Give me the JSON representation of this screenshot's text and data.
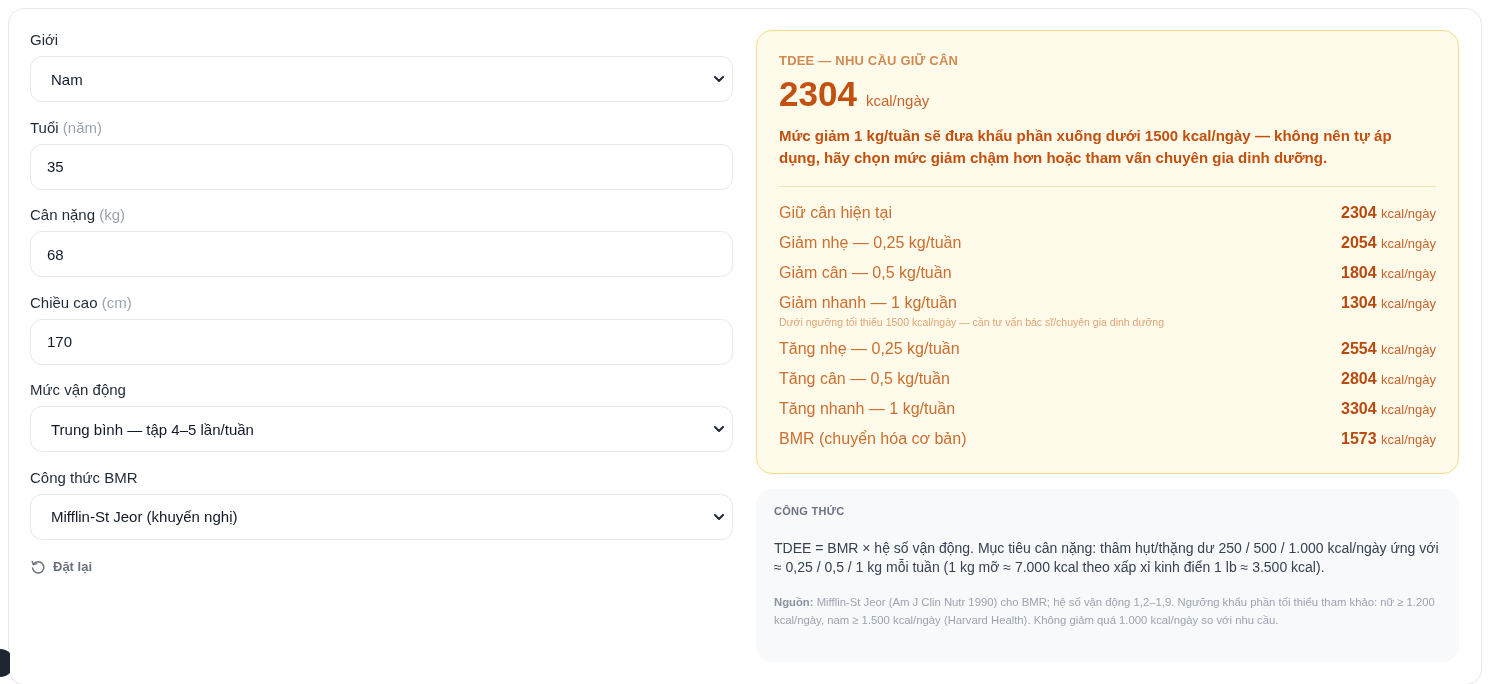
{
  "form": {
    "fields": [
      {
        "kind": "select",
        "label": "Giới",
        "value": "Nam"
      },
      {
        "kind": "number",
        "label": "Tuổi",
        "unit": "(năm)",
        "value": "35"
      },
      {
        "kind": "number",
        "label": "Cân nặng",
        "unit": "(kg)",
        "value": "68"
      },
      {
        "kind": "number",
        "label": "Chiều cao",
        "unit": "(cm)",
        "value": "170"
      },
      {
        "kind": "select",
        "label": "Mức vận động",
        "value": "Trung bình — tập 4–5 lần/tuần"
      },
      {
        "kind": "select",
        "label": "Công thức BMR",
        "value": "Mifflin-St Jeor (khuyến nghị)"
      }
    ],
    "reset_button": {
      "label": "Đặt lại"
    }
  },
  "result": {
    "title": "TDEE — NHU CẦU GIỮ CÂN",
    "tdee": {
      "value": "2304",
      "unit": "kcal/ngày"
    },
    "warning": "Mức giảm 1 kg/tuần sẽ đưa khẩu phần xuống dưới 1500 kcal/ngày — không nên tự áp dụng, hãy chọn mức giảm chậm hơn hoặc tham vấn chuyên gia dinh dưỡng.",
    "rows": [
      {
        "label": "Giữ cân hiện tại",
        "value": "2304",
        "unit": "kcal/ngày"
      },
      {
        "label": "Giảm nhẹ — 0,25 kg/tuần",
        "value": "2054",
        "unit": "kcal/ngày"
      },
      {
        "label": "Giảm cân — 0,5 kg/tuần",
        "value": "1804",
        "unit": "kcal/ngày"
      },
      {
        "label": "Giảm nhanh — 1 kg/tuần",
        "value": "1304",
        "unit": "kcal/ngày",
        "note": "Dưới ngưỡng tối thiểu 1500 kcal/ngày — cần tư vấn bác sĩ/chuyên gia dinh dưỡng"
      },
      {
        "label": "Tăng nhẹ — 0,25 kg/tuần",
        "value": "2554",
        "unit": "kcal/ngày"
      },
      {
        "label": "Tăng cân — 0,5 kg/tuần",
        "value": "2804",
        "unit": "kcal/ngày"
      },
      {
        "label": "Tăng nhanh — 1 kg/tuần",
        "value": "3304",
        "unit": "kcal/ngày"
      },
      {
        "label": "BMR (chuyển hóa cơ bản)",
        "value": "1573",
        "unit": "kcal/ngày"
      }
    ]
  },
  "formula": {
    "title": "CÔNG THỨC",
    "text": "TDEE = BMR × hệ số vận động. Mục tiêu cân nặng: thâm hụt/thặng dư 250 / 500 / 1.000 kcal/ngày ứng với ≈ 0,25 / 0,5 / 1 kg mỗi tuần (1 kg mỡ ≈ 7.000 kcal theo xấp xỉ kinh điển 1 lb ≈ 3.500 kcal).",
    "source": "**Nguồn:** Mifflin-St Jeor (Am J Clin Nutr 1990) cho BMR; hệ số vận động 1,2–1,9. Ngưỡng khẩu phần tối thiểu tham khảo: nữ ≥ 1.200 kcal/ngày, nam ≥ 1.500 kcal/ngày (Harvard Health). Không giảm quá 1.000 kcal/ngày so với nhu cầu."
  }
}
